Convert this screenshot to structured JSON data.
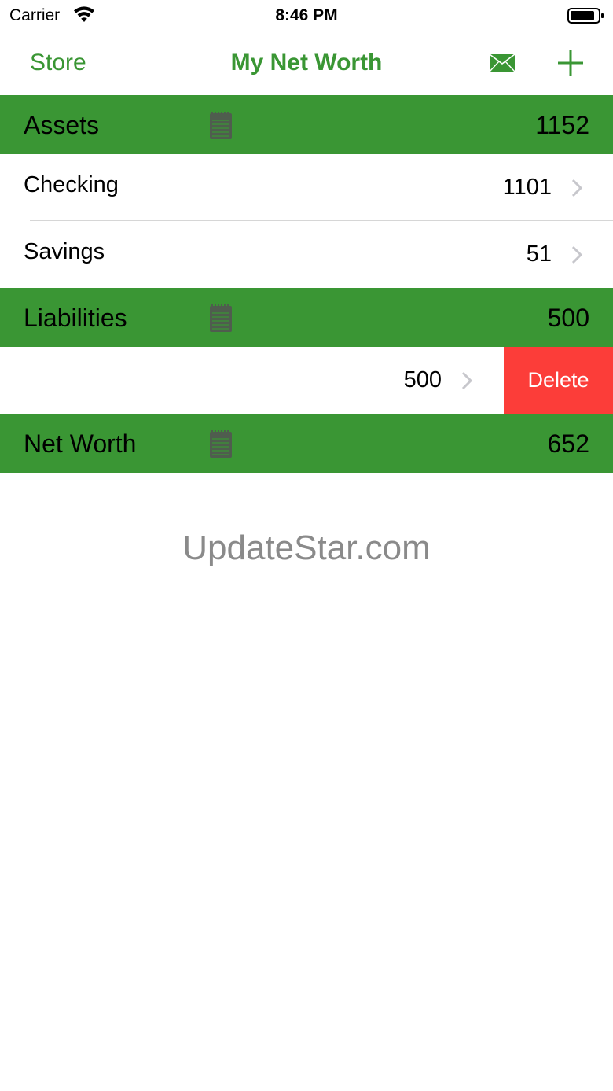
{
  "status_bar": {
    "carrier": "Carrier",
    "time": "8:46 PM",
    "icons": [
      "wifi-icon",
      "battery-icon"
    ]
  },
  "nav": {
    "left_button": "Store",
    "title": "My Net Worth",
    "icons": [
      "mail-icon",
      "plus-icon"
    ]
  },
  "sections": {
    "assets": {
      "title": "Assets",
      "total": "1152",
      "icon": "notepad-icon",
      "rows": [
        {
          "label": "Checking",
          "value": "1101"
        },
        {
          "label": "Savings",
          "value": "51"
        }
      ]
    },
    "liabilities": {
      "title": "Liabilities",
      "total": "500",
      "icon": "notepad-icon",
      "rows": [
        {
          "label": "",
          "value": "500",
          "action": "Delete"
        }
      ]
    },
    "net_worth": {
      "title": "Net Worth",
      "total": "652",
      "icon": "notepad-icon"
    }
  },
  "watermark": "UpdateStar.com",
  "colors": {
    "accent": "#3a9634",
    "delete": "#fc3d39",
    "watermark": "#8a8a8a",
    "separator": "#d6d6d6"
  }
}
